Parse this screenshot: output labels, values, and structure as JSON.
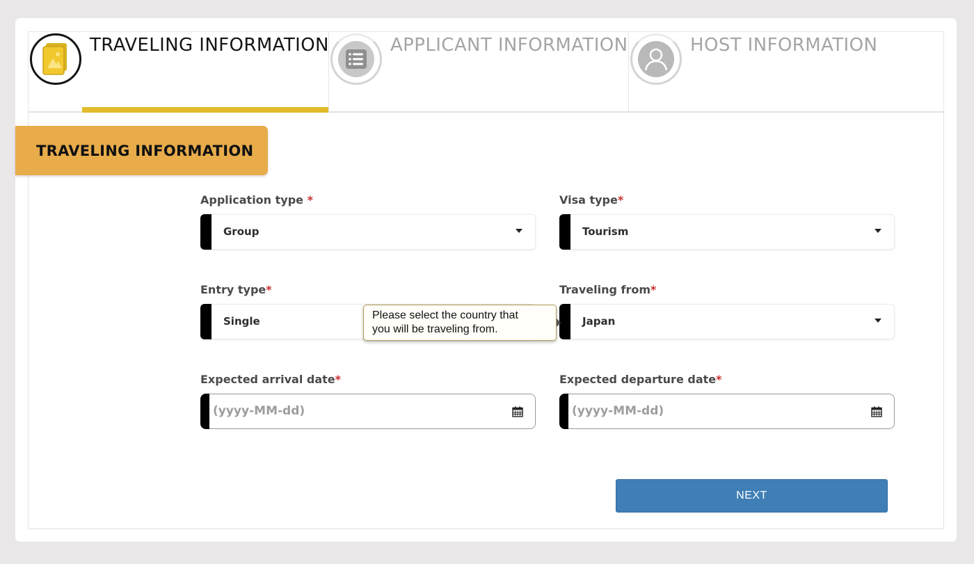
{
  "steps": [
    {
      "label": "TRAVELING INFORMATION",
      "icon": "passport-icon",
      "state": "active"
    },
    {
      "label": "APPLICANT INFORMATION",
      "icon": "list-icon",
      "state": "inactive"
    },
    {
      "label": "HOST INFORMATION",
      "icon": "user-icon",
      "state": "inactive"
    }
  ],
  "section": {
    "title": "TRAVELING INFORMATION"
  },
  "form": {
    "application_type": {
      "label": "Application type ",
      "required": "*",
      "value": "Group"
    },
    "visa_type": {
      "label": "Visa type",
      "required": "*",
      "value": "Tourism"
    },
    "entry_type": {
      "label": "Entry type",
      "required": "*",
      "value": "Single"
    },
    "traveling_from": {
      "label": "Traveling from",
      "required": "*",
      "value": "Japan"
    },
    "arrival_date": {
      "label": "Expected arrival date",
      "required": "*",
      "placeholder": "(yyyy-MM-dd)"
    },
    "departure_date": {
      "label": "Expected departure date",
      "required": "*",
      "placeholder": "(yyyy-MM-dd)"
    }
  },
  "tooltip": {
    "line1": "Please select the country that",
    "line2": "you will be traveling from."
  },
  "next_label": "NEXT",
  "colors": {
    "accent": "#e2bb2b",
    "section_tab": "#e8ac4b",
    "primary_button": "#3f7fb6",
    "required": "#c9302c"
  }
}
